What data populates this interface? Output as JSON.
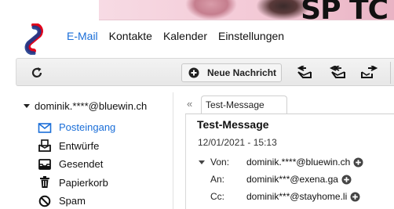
{
  "banner": {
    "text": "SP TC"
  },
  "nav": {
    "items": [
      "E-Mail",
      "Kontakte",
      "Kalender",
      "Einstellungen"
    ],
    "active_index": 0
  },
  "toolbar": {
    "new_message": "Neue Nachricht"
  },
  "sidebar": {
    "account": "dominik.****@bluewin.ch",
    "folders": [
      {
        "label": "Posteingang",
        "icon": "inbox-icon",
        "active": true
      },
      {
        "label": "Entwürfe",
        "icon": "drafts-icon",
        "active": false
      },
      {
        "label": "Gesendet",
        "icon": "sent-icon",
        "active": false
      },
      {
        "label": "Papierkorb",
        "icon": "trash-icon",
        "active": false
      },
      {
        "label": "Spam",
        "icon": "spam-icon",
        "active": false
      }
    ]
  },
  "message": {
    "tab_label": "Test-Message",
    "subject": "Test-Message",
    "date": "12/01/2021 - 15:13",
    "from_label": "Von:",
    "from": "dominik.****@bluewin.ch",
    "to_label": "An:",
    "to": "dominik***@exena.ga",
    "cc_label": "Cc:",
    "cc": "dominik***@stayhome.li"
  },
  "collapse_symbol": "«",
  "colors": {
    "accent": "#1a6ed8",
    "logo_red": "#e2001a",
    "logo_blue": "#1b3a8c"
  }
}
